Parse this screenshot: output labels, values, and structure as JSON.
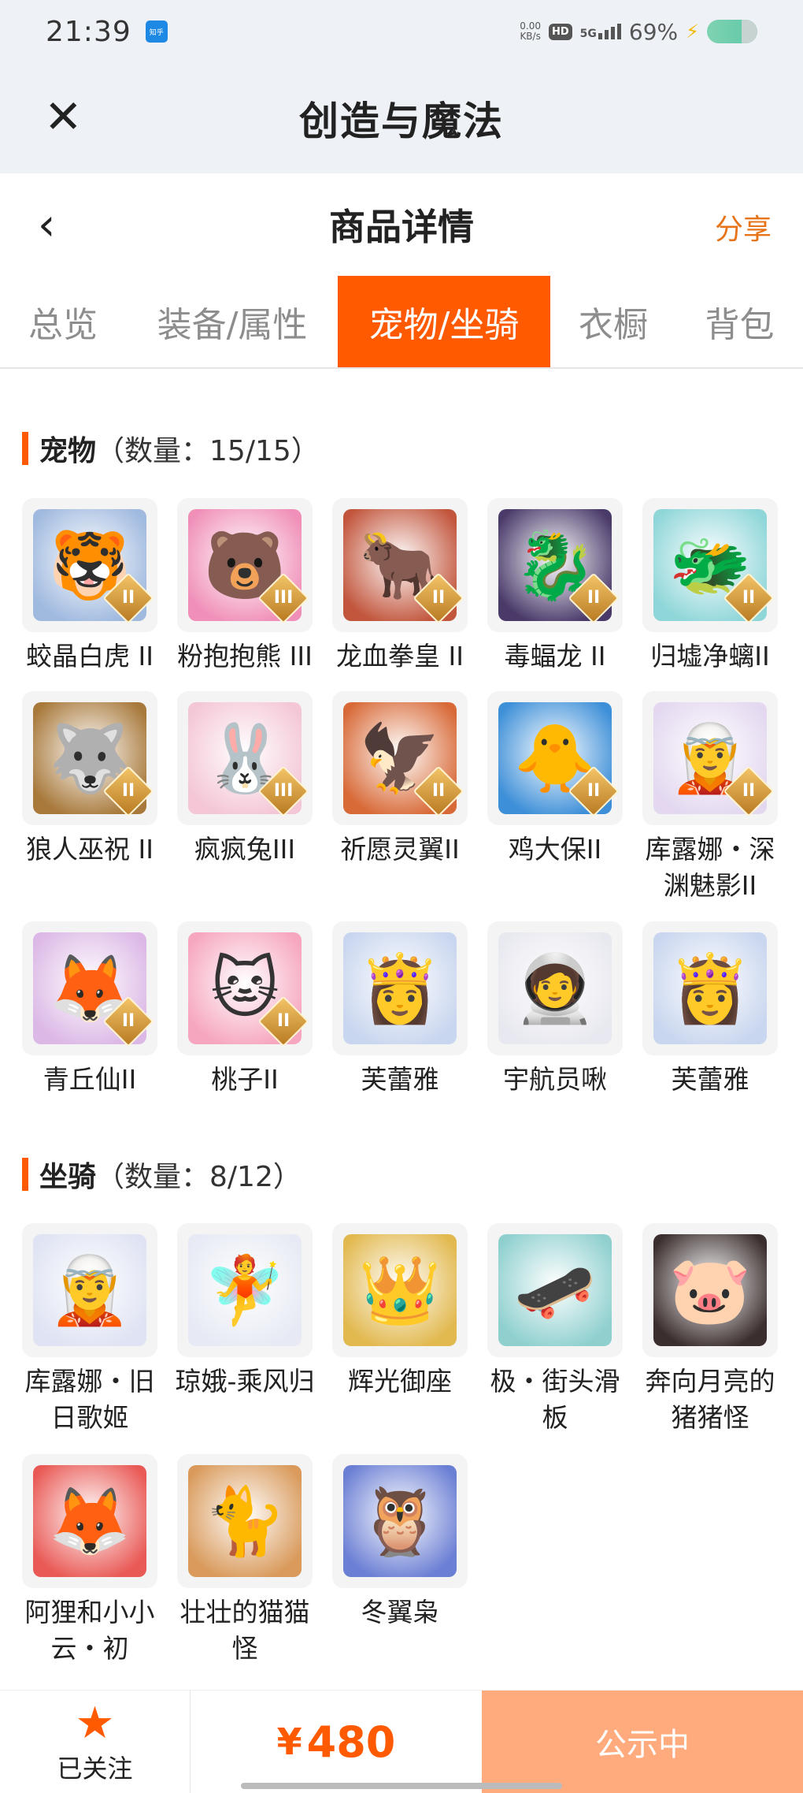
{
  "status_bar": {
    "time": "21:39",
    "app_badge": "知乎",
    "net_speed_value": "0.00",
    "net_speed_unit": "KB/s",
    "hd_label": "HD",
    "signal_label": "5G",
    "battery_percent": "69%"
  },
  "app": {
    "title": "创造与魔法"
  },
  "nav": {
    "title": "商品详情",
    "share_label": "分享"
  },
  "tabs": [
    {
      "label": "总览",
      "active": false
    },
    {
      "label": "装备/属性",
      "active": false
    },
    {
      "label": "宠物/坐骑",
      "active": true
    },
    {
      "label": "衣橱",
      "active": false
    },
    {
      "label": "背包",
      "active": false
    }
  ],
  "pets": {
    "title": "宠物",
    "count_text": "（数量：15/15）",
    "items": [
      {
        "name": "蛟晶白虎 II",
        "icon": "white-tiger",
        "rank": "II",
        "color": "#9fb9df"
      },
      {
        "name": "粉抱抱熊 III",
        "icon": "pink-bear",
        "rank": "III",
        "color": "#f08fb8"
      },
      {
        "name": "龙血拳皇 II",
        "icon": "red-beast",
        "rank": "II",
        "color": "#c2563d"
      },
      {
        "name": "毒蝠龙 II",
        "icon": "dark-dragon",
        "rank": "II",
        "color": "#4a3a6a"
      },
      {
        "name": "归墟净螭II",
        "icon": "cyan-dragon",
        "rank": "II",
        "color": "#8fd6d9"
      },
      {
        "name": "狼人巫祝 II",
        "icon": "wolf-shaman",
        "rank": "II",
        "color": "#a8793b"
      },
      {
        "name": "疯疯兔III",
        "icon": "crazy-rabbit",
        "rank": "III",
        "color": "#f4c6d6"
      },
      {
        "name": "祈愿灵翼II",
        "icon": "spirit-bird",
        "rank": "II",
        "color": "#d86a38"
      },
      {
        "name": "鸡大保II",
        "icon": "blue-chick",
        "rank": "II",
        "color": "#3d8fd8"
      },
      {
        "name": "库露娜・深渊魅影II",
        "icon": "kuluna",
        "rank": "II",
        "color": "#e3d8f0"
      },
      {
        "name": "青丘仙II",
        "icon": "fox-fairy",
        "rank": "II",
        "color": "#dcb8e6"
      },
      {
        "name": "桃子II",
        "icon": "pink-cat",
        "rank": "II",
        "color": "#f6a6bf"
      },
      {
        "name": "芙蕾雅",
        "icon": "freya",
        "rank": "",
        "color": "#c9d6ef"
      },
      {
        "name": "宇航员啾",
        "icon": "astronaut",
        "rank": "",
        "color": "#e8e8f0"
      },
      {
        "name": "芙蕾雅",
        "icon": "freya",
        "rank": "",
        "color": "#c9d6ef"
      }
    ]
  },
  "mounts": {
    "title": "坐骑",
    "count_text": "（数量：8/12）",
    "items": [
      {
        "name": "库露娜・旧日歌姬",
        "icon": "kuluna-singer",
        "rank": "",
        "color": "#dfe3f3"
      },
      {
        "name": "琼娥-乘风归",
        "icon": "moon-lady",
        "rank": "",
        "color": "#e7eaf4"
      },
      {
        "name": "辉光御座",
        "icon": "throne",
        "rank": "",
        "color": "#e2b94f"
      },
      {
        "name": "极・街头滑板",
        "icon": "skateboard",
        "rank": "",
        "color": "#8fd0cf"
      },
      {
        "name": "奔向月亮的猪猪怪",
        "icon": "pig",
        "rank": "",
        "color": "#3b2e2e"
      },
      {
        "name": "阿狸和小小云・初",
        "icon": "ali-cloud",
        "rank": "",
        "color": "#e95a56"
      },
      {
        "name": "壮壮的猫猫怪",
        "icon": "cat-monster",
        "rank": "",
        "color": "#d99a5b"
      },
      {
        "name": "冬翼枭",
        "icon": "owl",
        "rank": "",
        "color": "#6b7fd4"
      }
    ]
  },
  "bottom_bar": {
    "follow_label": "已关注",
    "currency": "¥",
    "price": "480",
    "status_label": "公示中"
  }
}
